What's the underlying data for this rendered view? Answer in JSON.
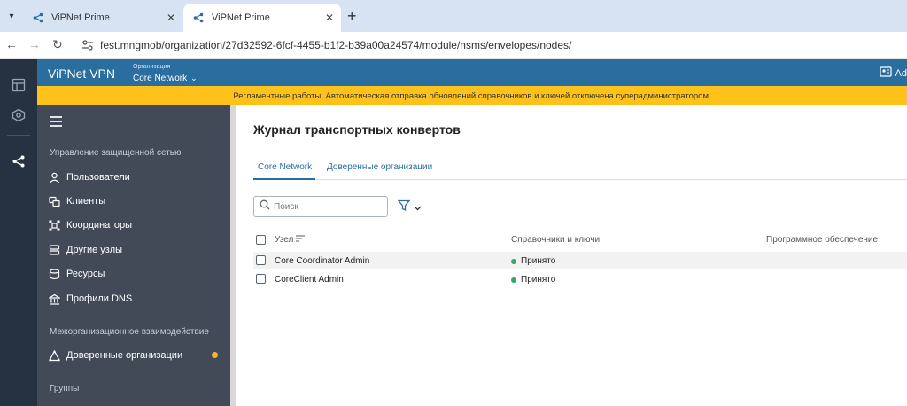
{
  "browser": {
    "tabs": [
      {
        "title": "ViPNet Prime",
        "active": false
      },
      {
        "title": "ViPNet Prime",
        "active": true
      }
    ],
    "new_tab": "+",
    "url": "fest.mngmob/organization/27d32592-6fcf-4455-b1f2-b39a00a24574/module/nsms/envelopes/nodes/"
  },
  "app": {
    "brand": "ViPNet VPN",
    "org_caption": "Организация",
    "org_value": "Core Network",
    "header_right": "Ad",
    "banner": "Регламентные работы. Автоматическая отправка обновлений справочников и ключей отключена суперадминистратором.",
    "accent": "#2a6d9f",
    "banner_color": "#ffc21a"
  },
  "sidebar": {
    "section1": "Управление защищенной сетью",
    "items": [
      {
        "label": "Пользователи",
        "icon": "user-icon"
      },
      {
        "label": "Клиенты",
        "icon": "clients-icon"
      },
      {
        "label": "Координаторы",
        "icon": "coordinator-icon"
      },
      {
        "label": "Другие узлы",
        "icon": "nodes-icon"
      },
      {
        "label": "Ресурсы",
        "icon": "resources-icon"
      },
      {
        "label": "Профили DNS",
        "icon": "dns-icon"
      }
    ],
    "section2": "Межорганизационное взаимодействие",
    "trusted": {
      "label": "Доверенные организации",
      "icon": "trusted-org-icon"
    },
    "section3": "Группы"
  },
  "main": {
    "title": "Журнал транспортных конвертов",
    "tabs": [
      {
        "label": "Core Network",
        "active": true
      },
      {
        "label": "Доверенные организации",
        "active": false
      }
    ],
    "search_placeholder": "Поиск",
    "columns": [
      "Узел",
      "Справочники и ключи",
      "Программное обеспечение"
    ],
    "rows": [
      {
        "node": "Core Coordinator Admin",
        "keys": "Принято"
      },
      {
        "node": "CoreClient Admin",
        "keys": "Принято"
      }
    ]
  }
}
